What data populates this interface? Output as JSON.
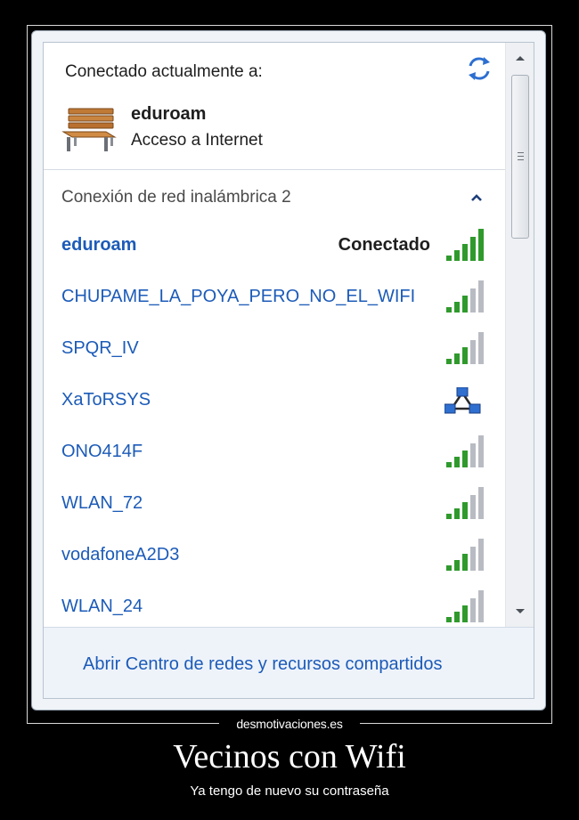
{
  "current": {
    "heading": "Conectado actualmente a:",
    "network_name": "eduroam",
    "network_status": "Acceso a Internet"
  },
  "section": {
    "title": "Conexión de red inalámbrica 2"
  },
  "networks": [
    {
      "name": "eduroam",
      "state": "Conectado",
      "signal_bars": 5,
      "type": "wifi"
    },
    {
      "name": "CHUPAME_LA_POYA_PERO_NO_EL_WIFI",
      "state": "",
      "signal_bars": 3,
      "type": "wifi"
    },
    {
      "name": "SPQR_IV",
      "state": "",
      "signal_bars": 3,
      "type": "wifi"
    },
    {
      "name": "XaToRSYS",
      "state": "",
      "signal_bars": 0,
      "type": "adhoc"
    },
    {
      "name": "ONO414F",
      "state": "",
      "signal_bars": 3,
      "type": "wifi"
    },
    {
      "name": "WLAN_72",
      "state": "",
      "signal_bars": 3,
      "type": "wifi"
    },
    {
      "name": "vodafoneA2D3",
      "state": "",
      "signal_bars": 3,
      "type": "wifi"
    },
    {
      "name": "WLAN_24",
      "state": "",
      "signal_bars": 3,
      "type": "wifi"
    }
  ],
  "footer": {
    "link": "Abrir Centro de redes y recursos compartidos"
  },
  "poster": {
    "watermark": "desmotivaciones.es",
    "title": "Vecinos con Wifi",
    "subtitle": "Ya tengo de nuevo su contraseña"
  },
  "colors": {
    "link": "#1c5bb8",
    "signal_on": "#2f9a2c",
    "signal_off": "#b8bcc2"
  }
}
